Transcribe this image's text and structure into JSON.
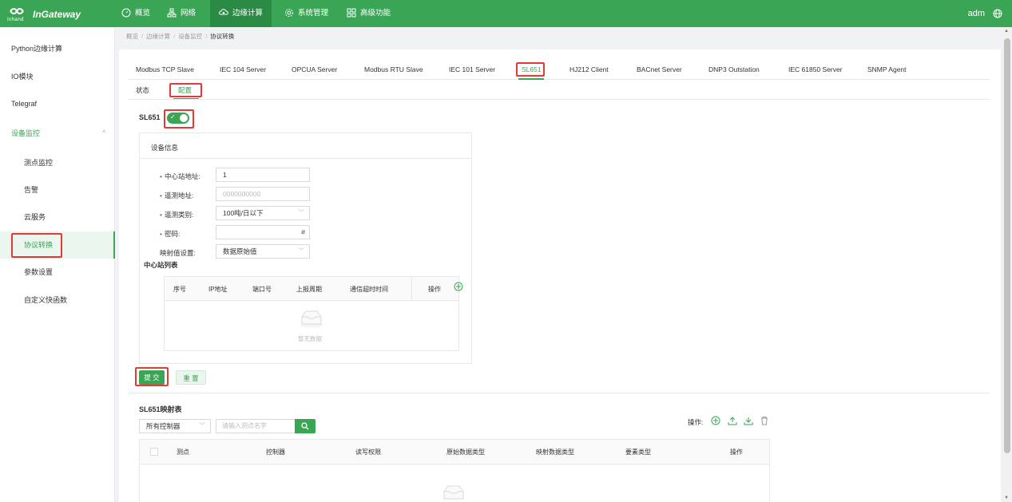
{
  "app": {
    "brand": "InGateway",
    "logo_sub": "inhand"
  },
  "nav": [
    {
      "label": "概览",
      "icon": "dashboard-icon"
    },
    {
      "label": "网络",
      "icon": "network-icon"
    },
    {
      "label": "边缘计算",
      "icon": "edge-computing-icon",
      "active": true
    },
    {
      "label": "系统管理",
      "icon": "gear-icon"
    },
    {
      "label": "高级功能",
      "icon": "grid-icon"
    }
  ],
  "user": {
    "name": "adm",
    "icon": "globe-icon"
  },
  "sidebar": {
    "items": [
      {
        "label": "Python边缘计算"
      },
      {
        "label": "IO模块"
      },
      {
        "label": "Telegraf"
      },
      {
        "label": "设备监控",
        "expanded": true,
        "caret": "^"
      },
      {
        "label": "测点监控"
      },
      {
        "label": "告警"
      },
      {
        "label": "云服务"
      },
      {
        "label": "协议转换",
        "selected": true
      },
      {
        "label": "参数设置"
      },
      {
        "label": "自定义快函数"
      }
    ]
  },
  "breadcrumb": [
    "概览",
    "边缘计算",
    "设备监控",
    "协议转换"
  ],
  "breadcrumb_sep": "/",
  "protocol_tabs": [
    "Modbus TCP Slave",
    "IEC 104 Server",
    "OPCUA Server",
    "Modbus RTU Slave",
    "IEC 101 Server",
    "SL651",
    "HJ212 Client",
    "BACnet Server",
    "DNP3 Outstation",
    "IEC 61850 Server",
    "SNMP Agent"
  ],
  "protocol_active": "SL651",
  "sub_tabs": [
    "状态",
    "配置"
  ],
  "sub_active": "配置",
  "sl651": {
    "label": "SL651",
    "enabled": true,
    "switch_check": "✓",
    "card_title": "设备信息",
    "form": {
      "center_addr_label": "中心站地址:",
      "center_addr_value": "1",
      "remote_addr_label": "遥测地址:",
      "remote_addr_placeholder": "0000000000",
      "remote_type_label": "遥测类别:",
      "remote_type_value": "100吨/日以下",
      "password_label": "密码:",
      "mapping_label": "映射值设置:",
      "mapping_value": "数据原始值"
    },
    "required_mark": "•",
    "center_list_title": "中心站列表",
    "center_table_headers": [
      "序号",
      "IP地址",
      "端口号",
      "上报周期",
      "通信超时时间",
      "操作"
    ],
    "empty_text": "暂无数据"
  },
  "buttons": {
    "submit": "提 交",
    "reset": "重 置"
  },
  "mapping": {
    "title": "SL651映射表",
    "controller_select": "所有控制器",
    "search_placeholder": "请输入测点名字",
    "ops_label": "操作:",
    "headers": [
      "测点",
      "控制器",
      "读写权限",
      "原始数据类型",
      "映射数据类型",
      "要素类型",
      "操作"
    ]
  },
  "colors": {
    "primary": "#3aa655",
    "highlight": "#e53935"
  }
}
